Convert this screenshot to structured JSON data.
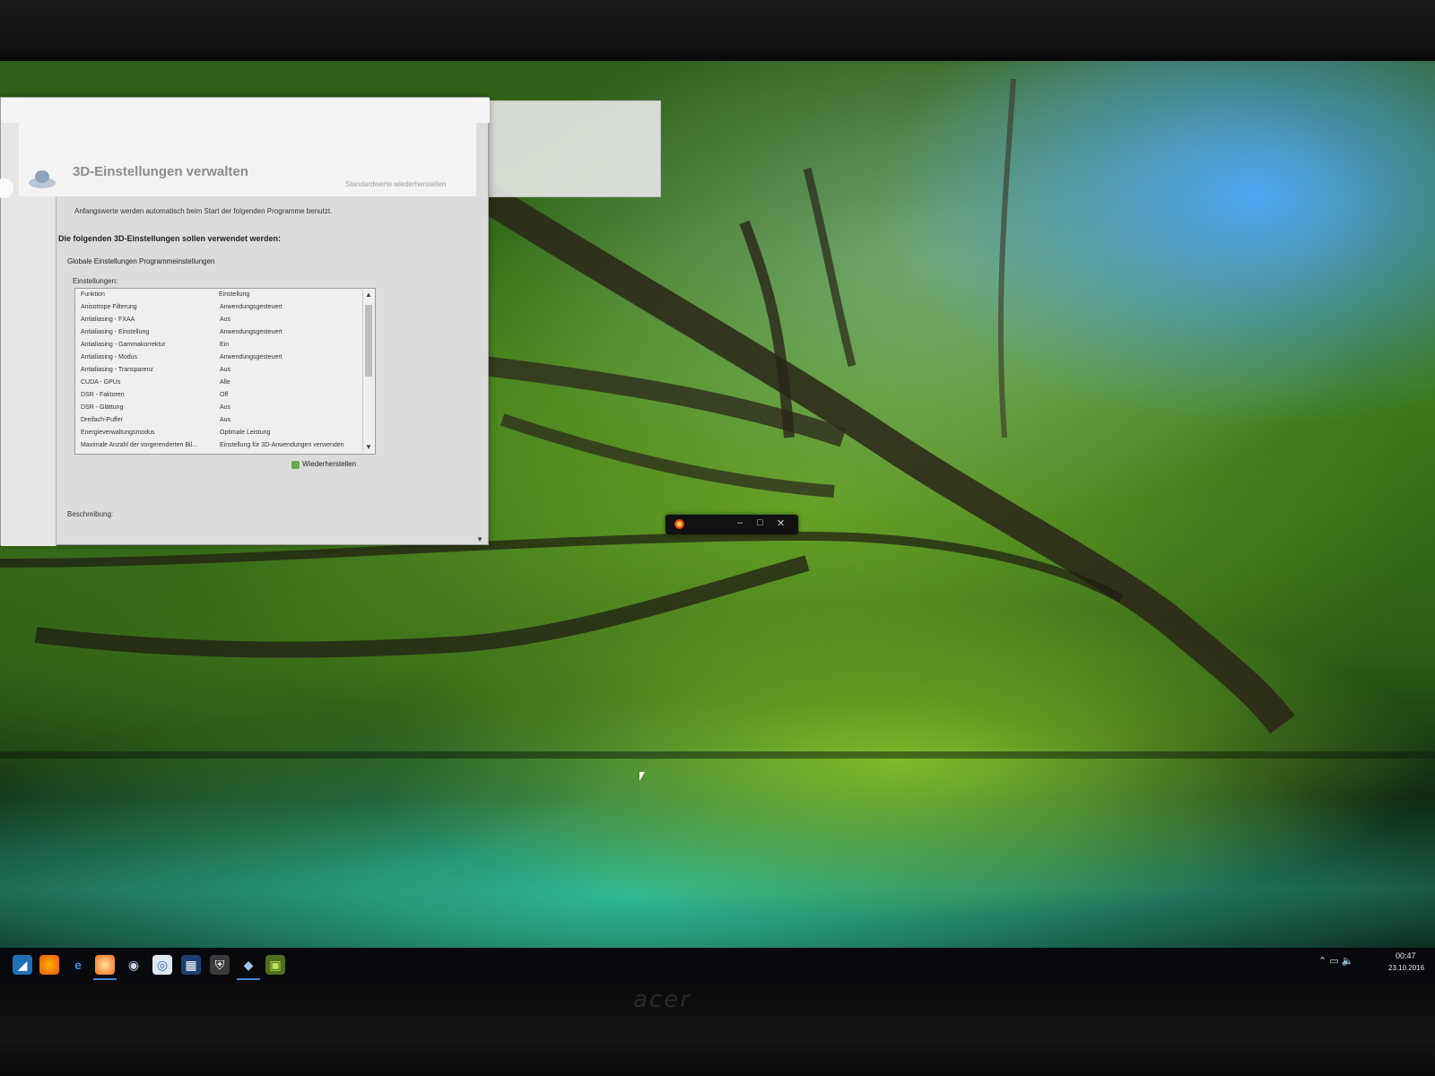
{
  "window": {
    "title": "3D-Einstellungen verwalten",
    "restore_link": "Standardwerte wiederherstellen",
    "description": "Anfangswerte werden automatisch beim Start der folgenden Programme benutzt.",
    "subheading": "Die folgenden 3D-Einstellungen sollen verwendet werden:",
    "tabs": [
      "Globale Einstellungen",
      "Programmeinstellungen"
    ],
    "settings_label": "Einstellungen:",
    "columns": [
      "Funktion",
      "Einstellung"
    ],
    "rows": [
      {
        "function": "Anisotrope Filterung",
        "value": "Anwendungsgesteuert"
      },
      {
        "function": "Antialiasing - FXAA",
        "value": "Aus"
      },
      {
        "function": "Antialiasing - Einstellung",
        "value": "Anwendungsgesteuert"
      },
      {
        "function": "Antialiasing - Gammakorrektur",
        "value": "Ein"
      },
      {
        "function": "Antialiasing - Modus",
        "value": "Anwendungsgesteuert"
      },
      {
        "function": "Antialiasing - Transparenz",
        "value": "Aus"
      },
      {
        "function": "CUDA - GPUs",
        "value": "Alle"
      },
      {
        "function": "DSR - Faktoren",
        "value": "Off"
      },
      {
        "function": "DSR - Glättung",
        "value": "Aus"
      },
      {
        "function": "Dreifach-Puffer",
        "value": "Aus"
      },
      {
        "function": "Energieverwaltungsmodus",
        "value": "Optimale Leistung"
      },
      {
        "function": "Maximale Anzahl der vorgerenderten Bil...",
        "value": "Einstellung für 3D-Anwendungen verwenden"
      }
    ],
    "restore_button": "Wiederherstellen",
    "description_label": "Beschreibung:"
  },
  "taskbar": {
    "time": "00:47",
    "date": "23.10.2016",
    "icons": [
      "start-icon",
      "firefox-icon",
      "edge-icon",
      "origin-icon",
      "steam-icon",
      "chrome-icon",
      "app-icon",
      "shield-icon",
      "app2-icon",
      "nvidia-icon"
    ]
  },
  "monitor": {
    "brand": "acer"
  }
}
